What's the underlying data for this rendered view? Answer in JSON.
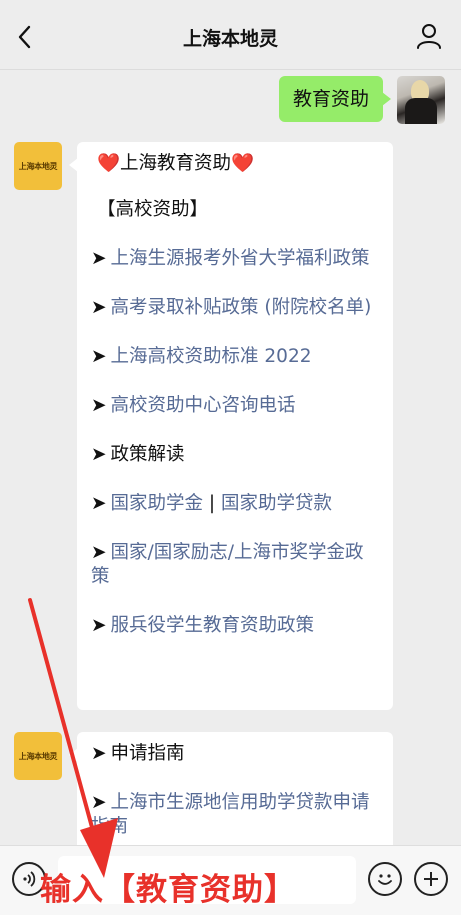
{
  "header": {
    "title": "上海本地灵"
  },
  "user_message": {
    "text": "教育资助"
  },
  "bot": {
    "avatar_label": "上海本地灵"
  },
  "bubble1": {
    "heading": "❤️上海教育资助❤️",
    "section": "【高校资助】",
    "items": [
      "上海生源报考外省大学福利政策",
      "高考录取补贴政策 (附院校名单)",
      "上海高校资助标准 2022",
      "高校资助中心咨询电话",
      "政策解读",
      "国家助学金",
      "国家助学贷款",
      "国家/国家励志/上海市奖学金政策",
      "服兵役学生教育资助政策"
    ],
    "separator": "|",
    "arrow": "➤"
  },
  "bubble2": {
    "items": [
      "申请指南",
      "上海市生源地信用助学贷款申请指南"
    ]
  },
  "composer": {
    "annotation": "输入【教育资助】"
  },
  "colors": {
    "user_bubble": "#95ec69",
    "link": "#576b95",
    "annotation": "#e8312a",
    "bot_avatar": "#f2bf3a"
  },
  "icons": [
    "back-icon",
    "profile-icon",
    "voice-icon",
    "emoji-icon",
    "plus-icon"
  ]
}
